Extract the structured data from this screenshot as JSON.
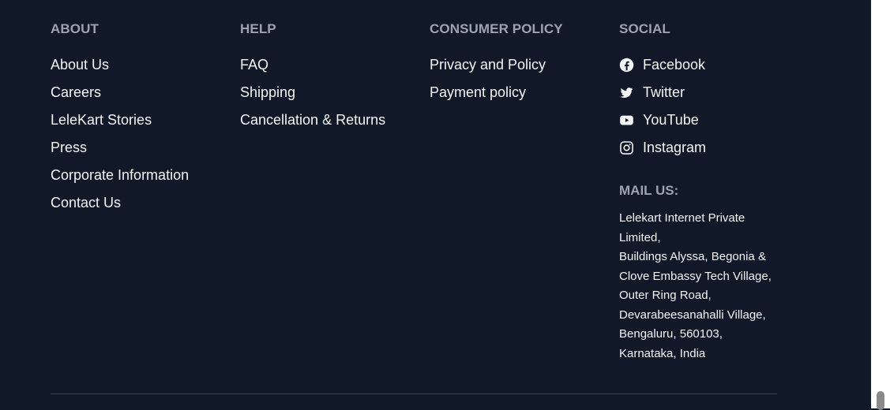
{
  "footer": {
    "about": {
      "heading": "ABOUT",
      "links": [
        "About Us",
        "Careers",
        "LeleKart Stories",
        "Press",
        "Corporate Information",
        "Contact Us"
      ]
    },
    "help": {
      "heading": "HELP",
      "links": [
        "FAQ",
        "Shipping",
        "Cancellation & Returns"
      ]
    },
    "consumer_policy": {
      "heading": "CONSUMER POLICY",
      "links": [
        "Privacy and Policy",
        "Payment policy"
      ]
    },
    "social": {
      "heading": "SOCIAL",
      "links": [
        {
          "label": "Facebook",
          "icon": "facebook-icon"
        },
        {
          "label": "Twitter",
          "icon": "twitter-icon"
        },
        {
          "label": "YouTube",
          "icon": "youtube-icon"
        },
        {
          "label": "Instagram",
          "icon": "instagram-icon"
        }
      ]
    },
    "mail": {
      "heading": "MAIL US:",
      "lines": [
        "Lelekart Internet Private Limited,",
        "Buildings Alyssa, Begonia & Clove Embassy Tech Village,",
        "Outer Ring Road, Devarabeesanahalli Village,",
        "Bengaluru, 560103,",
        "Karnataka, India"
      ]
    }
  },
  "colors": {
    "background": "#111827",
    "heading": "#9ca3af",
    "link": "#f3f4f6",
    "divider": "#374151"
  }
}
